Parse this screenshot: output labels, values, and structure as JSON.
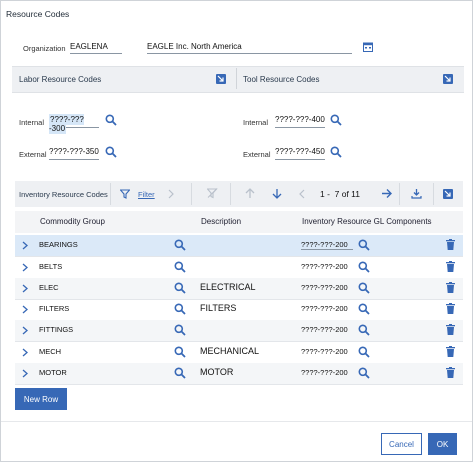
{
  "dialog": {
    "title": "Resource Codes"
  },
  "organization": {
    "label": "Organization",
    "code": "EAGLENA",
    "name": "EAGLE Inc. North America"
  },
  "labor_section": {
    "title": "Labor Resource Codes",
    "internal_label": "Internal",
    "internal_value": "????-???-300",
    "external_label": "External",
    "external_value": "????-???-350"
  },
  "tool_section": {
    "title": "Tool Resource Codes",
    "internal_label": "Internal",
    "internal_value": "????-???-400",
    "external_label": "External",
    "external_value": "????-???-450"
  },
  "inventory": {
    "title": "Inventory Resource Codes",
    "filter_label": "Filter",
    "pagination": {
      "range": "1 -  7 of 11"
    },
    "columns": {
      "commodity": "Commodity Group",
      "description": "Description",
      "gl": "Inventory Resource GL Components"
    },
    "rows": [
      {
        "commodity": "BEARINGS",
        "description": "",
        "gl": "????-???-200"
      },
      {
        "commodity": "BELTS",
        "description": "",
        "gl": "????-???-200"
      },
      {
        "commodity": "ELEC",
        "description": "ELECTRICAL",
        "gl": "????-???-200"
      },
      {
        "commodity": "FILTERS",
        "description": "FILTERS",
        "gl": "????-???-200"
      },
      {
        "commodity": "FITTINGS",
        "description": "",
        "gl": "????-???-200"
      },
      {
        "commodity": "MECH",
        "description": "MECHANICAL",
        "gl": "????-???-200"
      },
      {
        "commodity": "MOTOR",
        "description": "MOTOR",
        "gl": "????-???-200"
      }
    ],
    "new_row_label": "New Row"
  },
  "footer": {
    "cancel_label": "Cancel",
    "ok_label": "OK"
  },
  "colors": {
    "accent": "#3768b6",
    "selected_row": "#dbe9f8",
    "section_bg": "#eef0f3"
  }
}
